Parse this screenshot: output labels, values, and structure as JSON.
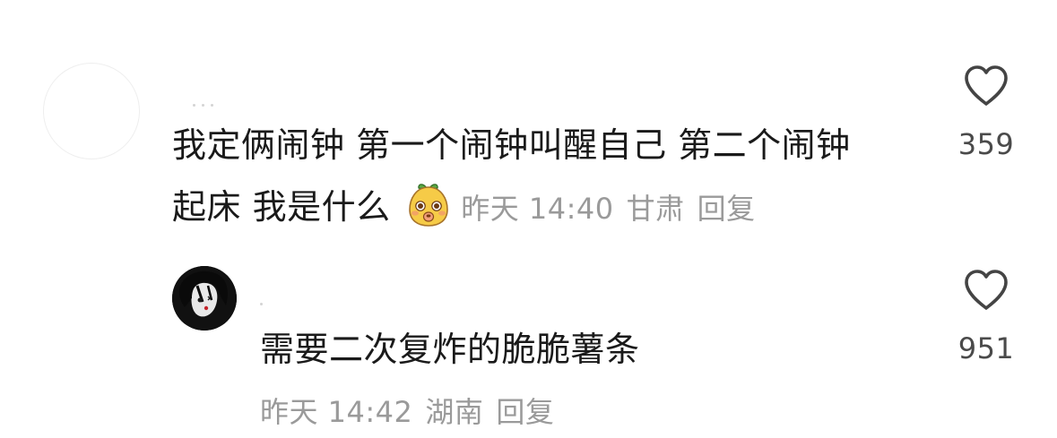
{
  "comments": [
    {
      "text_line1": "我定俩闹钟 第一个闹钟叫醒自己 第二个闹钟",
      "text_line2": "起床 我是什么",
      "emoji": "potato-face-emoji",
      "time": "昨天 14:40",
      "location": "甘肃",
      "reply_label": "回复",
      "likes": "359"
    },
    {
      "text_line1": "需要二次复炸的脆脆薯条",
      "time": "昨天 14:42",
      "location": "湖南",
      "reply_label": "回复",
      "likes": "951"
    }
  ],
  "icons": {
    "like": "heart-outline-icon"
  },
  "colors": {
    "text": "#1a1a1a",
    "meta": "#9a9a9a",
    "like_count": "#4a4a4a",
    "heart": "#444444"
  }
}
